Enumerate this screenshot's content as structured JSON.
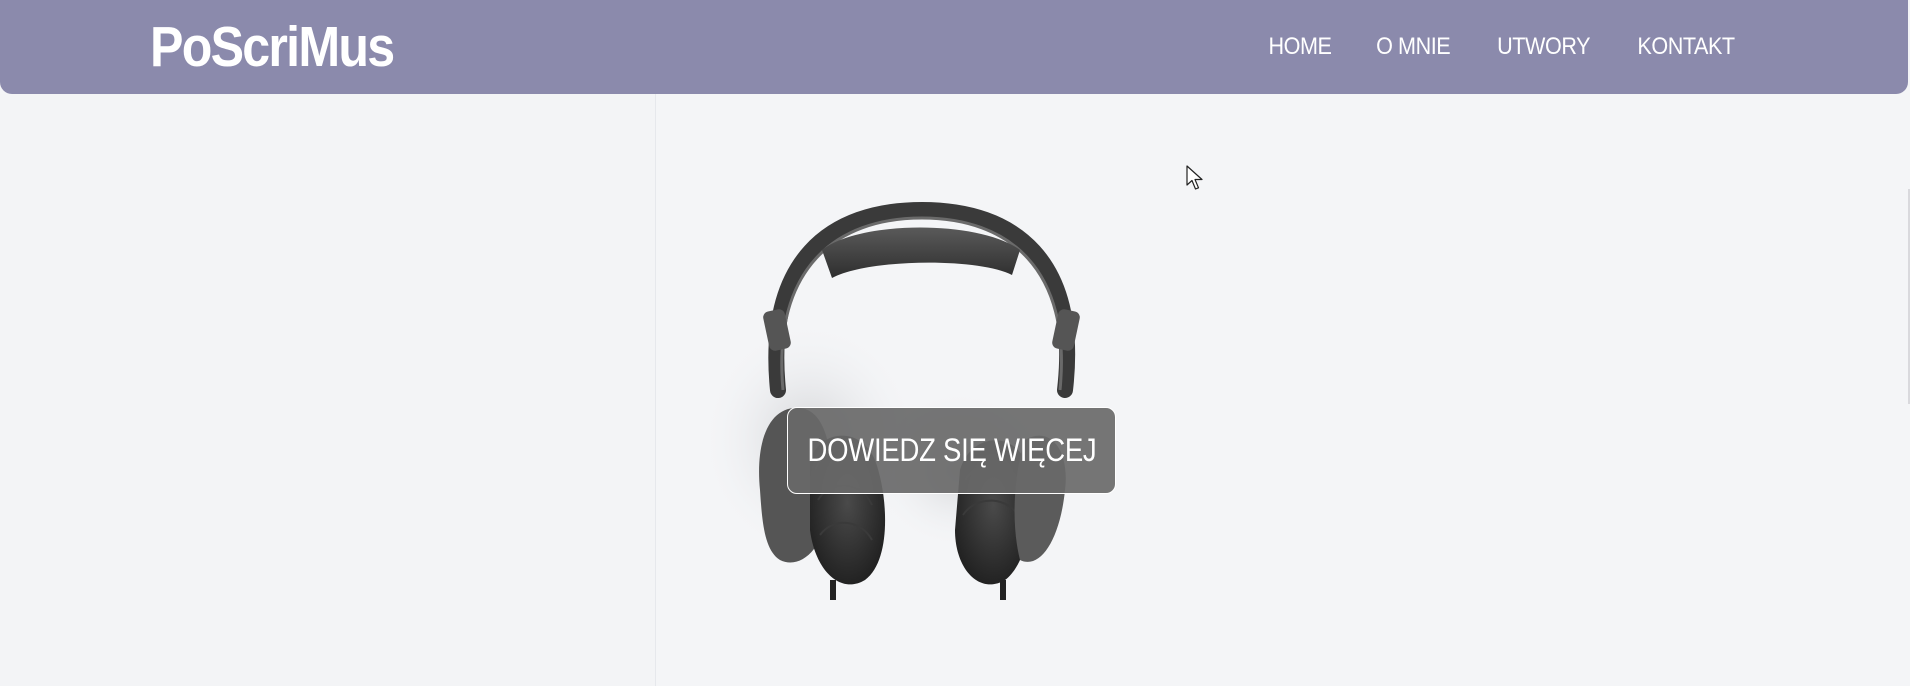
{
  "site": {
    "logo": "PoScriMus"
  },
  "nav": {
    "items": [
      {
        "label": "HOME"
      },
      {
        "label": "O MNIE"
      },
      {
        "label": "UTWORY"
      },
      {
        "label": "KONTAKT"
      }
    ]
  },
  "hero": {
    "cta_label": "DOWIEDZ SIĘ WIĘCEJ",
    "image_icon": "headphones-icon"
  },
  "colors": {
    "header_bg": "#8b8aac",
    "page_bg": "#f4f5f7",
    "cta_bg": "#696969",
    "text_light": "#ffffff"
  }
}
